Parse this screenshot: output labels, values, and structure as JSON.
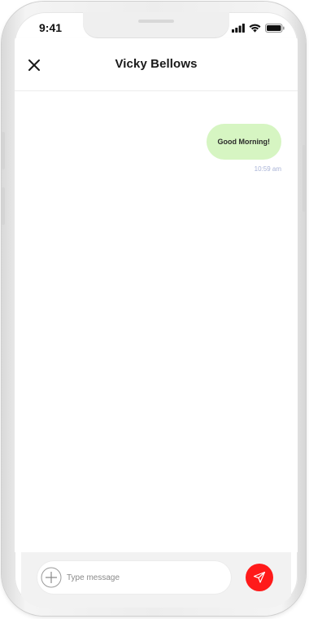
{
  "status_bar": {
    "time": "9:41"
  },
  "header": {
    "title": "Vicky Bellows",
    "close_icon": "close-icon"
  },
  "messages": [
    {
      "text": "Good Morning!",
      "time": "10:59 am",
      "direction": "outgoing"
    }
  ],
  "composer": {
    "placeholder": "Type message",
    "value": "",
    "add_icon": "plus-circle-icon",
    "send_icon": "send-arrow-icon"
  },
  "colors": {
    "outgoing_bubble": "#d6f5c2",
    "send_button": "#ff1a1a",
    "timestamp": "#a9b3d6"
  }
}
